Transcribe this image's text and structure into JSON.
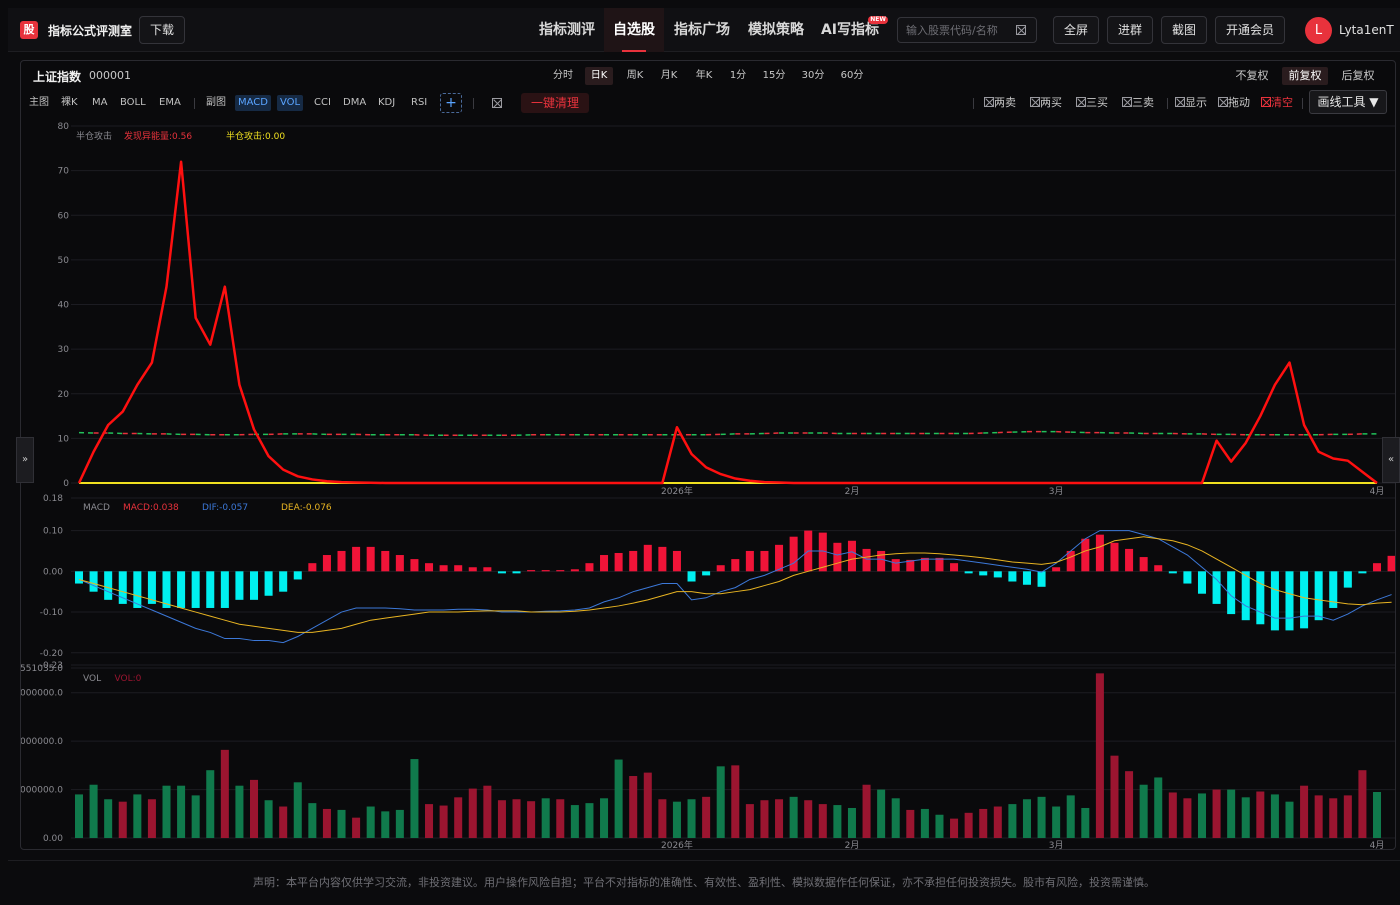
{
  "app": {
    "logo_char": "股",
    "title": "指标公式评测室",
    "download_label": "下载"
  },
  "nav": [
    {
      "label": "指标测评",
      "active": false
    },
    {
      "label": "自选股",
      "active": true
    },
    {
      "label": "指标广场",
      "active": false
    },
    {
      "label": "模拟策略",
      "active": false
    },
    {
      "label": "AI写指标",
      "active": false,
      "badge": "NEW"
    }
  ],
  "search": {
    "placeholder": "输入股票代码/名称"
  },
  "header_buttons": {
    "fullscreen": "全屏",
    "join_group": "进群",
    "screenshot": "截图",
    "vip": "开通会员"
  },
  "user": {
    "avatar_letter": "L",
    "name": "Lyta1enT"
  },
  "stock": {
    "name": "上证指数",
    "code": "000001"
  },
  "periods": [
    {
      "label": "分时",
      "active": false
    },
    {
      "label": "日K",
      "active": true
    },
    {
      "label": "周K",
      "active": false
    },
    {
      "label": "月K",
      "active": false
    },
    {
      "label": "年K",
      "active": false
    },
    {
      "label": "1分",
      "active": false
    },
    {
      "label": "15分",
      "active": false
    },
    {
      "label": "30分",
      "active": false
    },
    {
      "label": "60分",
      "active": false
    }
  ],
  "adjust": [
    {
      "label": "不复权",
      "active": false
    },
    {
      "label": "前复权",
      "active": true
    },
    {
      "label": "后复权",
      "active": false
    }
  ],
  "indicator_tools": {
    "main_label": "主图",
    "main_items": [
      "裸K",
      "MA",
      "BOLL",
      "EMA"
    ],
    "sub_label": "副图",
    "sub_items": [
      "MACD",
      "VOL",
      "CCI",
      "DMA",
      "KDJ",
      "RSI"
    ],
    "add": "+",
    "clear": "一键清理"
  },
  "draw_tools": [
    {
      "label": "两卖",
      "red": false
    },
    {
      "label": "两买",
      "red": false
    },
    {
      "label": "三买",
      "red": false
    },
    {
      "label": "三卖",
      "red": false
    },
    {
      "label": "显示",
      "red": false
    },
    {
      "label": "拖动",
      "red": false
    },
    {
      "label": "清空",
      "red": true
    }
  ],
  "draw_button": "画线工具 ▼",
  "side_tabs": {
    "left": "»",
    "right": "«"
  },
  "colors": {
    "accent": "#e8323c",
    "up": "#f01438",
    "down": "#00f0f0",
    "vol_up": "#9b1530",
    "vol_down": "#107a4c",
    "dif": "#3c78d8",
    "dea": "#e8b422",
    "signal_yellow": "#f0e020"
  },
  "chart_data": [
    {
      "type": "line",
      "legend": [
        {
          "name": "半仓攻击",
          "value": "",
          "color": "#8a8a90"
        },
        {
          "name": "发现异能量",
          "value": "0.56",
          "color": "#e8323c"
        },
        {
          "name": "半仓攻击",
          "value": "0.00",
          "color": "#f0e020"
        }
      ],
      "ylim": [
        0,
        80
      ],
      "yticks": [
        0,
        10,
        20,
        30,
        40,
        50,
        60,
        70,
        80
      ],
      "x_labels": [
        "2026年",
        "2月",
        "3月",
        "4月"
      ],
      "x_label_index": [
        41,
        53,
        67,
        89
      ],
      "n": 90,
      "series": [
        {
          "name": "发现异能量",
          "color": "#ff1010",
          "values": [
            0,
            7,
            13,
            16,
            22,
            27,
            44,
            72,
            37,
            31,
            44,
            22,
            12,
            6,
            3,
            1.5,
            0.8,
            0.4,
            0.2,
            0.1,
            0.05,
            0,
            0,
            0,
            0,
            0,
            0,
            0,
            0,
            0,
            0,
            0,
            0,
            0,
            0,
            0,
            0,
            0,
            0,
            0,
            0,
            12.5,
            6.5,
            3.5,
            2,
            1,
            0.5,
            0.2,
            0.1,
            0,
            0,
            0,
            0,
            0,
            0,
            0,
            0,
            0,
            0,
            0,
            0,
            0,
            0,
            0,
            0,
            0,
            0,
            0,
            0,
            0,
            0,
            0,
            0,
            0,
            0,
            0,
            0,
            0,
            9.5,
            4.8,
            9,
            15,
            22,
            27,
            13,
            7,
            5.5,
            5,
            2.5,
            0
          ]
        },
        {
          "name": "半仓攻击",
          "color": "#f0e020",
          "values": [
            0,
            0,
            0,
            0,
            0,
            0,
            0,
            0,
            0,
            0,
            0,
            0,
            0,
            0,
            0,
            0,
            0,
            0,
            0,
            0,
            0,
            0,
            0,
            0,
            0,
            0,
            0,
            0,
            0,
            0,
            0,
            0,
            0,
            0,
            0,
            0,
            0,
            0,
            0,
            0,
            0,
            0,
            0,
            0,
            0,
            0,
            0,
            0,
            0,
            0,
            0,
            0,
            0,
            0,
            0,
            0,
            0,
            0,
            0,
            0,
            0,
            0,
            0,
            0,
            0,
            0,
            0,
            0,
            0,
            0,
            0,
            0,
            0,
            0,
            0,
            0,
            0,
            0,
            0,
            0,
            0,
            0,
            0,
            0,
            0,
            0,
            0,
            0,
            0,
            0
          ]
        },
        {
          "name": "dashed-level",
          "color": "#22c05a",
          "alt_color": "#e8323c",
          "dashed": true,
          "values": [
            11.3,
            11.2,
            11.2,
            11.1,
            11.1,
            11,
            11,
            10.9,
            10.9,
            10.8,
            10.8,
            10.8,
            10.9,
            10.9,
            11,
            11,
            11,
            10.9,
            10.9,
            10.9,
            10.8,
            10.8,
            10.8,
            10.8,
            10.7,
            10.7,
            10.7,
            10.7,
            10.7,
            10.7,
            10.7,
            10.8,
            10.8,
            10.8,
            10.8,
            10.8,
            10.8,
            10.8,
            10.8,
            10.8,
            10.8,
            10.8,
            10.8,
            10.8,
            10.9,
            11,
            11,
            11.1,
            11.2,
            11.2,
            11.2,
            11.2,
            11.1,
            11.1,
            11.1,
            11.1,
            11.1,
            11.1,
            11.1,
            11.1,
            11.1,
            11.1,
            11.2,
            11.3,
            11.4,
            11.5,
            11.5,
            11.5,
            11.4,
            11.3,
            11.3,
            11.2,
            11.2,
            11.1,
            11.1,
            11.1,
            11,
            11,
            10.9,
            10.9,
            10.8,
            10.8,
            10.8,
            10.8,
            10.8,
            10.8,
            10.9,
            10.9,
            11,
            11
          ]
        }
      ]
    },
    {
      "type": "bar",
      "legend": [
        {
          "name": "MACD",
          "value": "",
          "color": "#8a8a90"
        },
        {
          "name": "MACD",
          "value": "0.038",
          "color": "#e8323c"
        },
        {
          "name": "DIF",
          "value": "-0.057",
          "color": "#3c78d8"
        },
        {
          "name": "DEA",
          "value": "-0.076",
          "color": "#e8b422"
        }
      ],
      "ylim": [
        -0.23,
        0.18
      ],
      "yticks": [
        0.18,
        0.1,
        0.0,
        -0.1,
        -0.2,
        -0.23
      ],
      "ytick_labels": [
        "0.18",
        "0.10",
        "0.00",
        "-0.10",
        "-0.20",
        "-0.23"
      ],
      "macd": [
        -0.03,
        -0.05,
        -0.07,
        -0.08,
        -0.09,
        -0.08,
        -0.09,
        -0.09,
        -0.09,
        -0.09,
        -0.09,
        -0.07,
        -0.07,
        -0.06,
        -0.05,
        -0.02,
        0.02,
        0.04,
        0.05,
        0.06,
        0.06,
        0.05,
        0.04,
        0.03,
        0.02,
        0.015,
        0.015,
        0.01,
        0.01,
        -0.005,
        -0.005,
        0.003,
        0.003,
        0.003,
        0.005,
        0.02,
        0.04,
        0.045,
        0.05,
        0.065,
        0.06,
        0.05,
        -0.025,
        -0.01,
        0.015,
        0.03,
        0.05,
        0.05,
        0.065,
        0.085,
        0.1,
        0.095,
        0.07,
        0.075,
        0.055,
        0.05,
        0.03,
        0.028,
        0.033,
        0.033,
        0.02,
        -0.005,
        -0.01,
        -0.015,
        -0.025,
        -0.033,
        -0.038,
        0.01,
        0.05,
        0.08,
        0.09,
        0.07,
        0.055,
        0.035,
        0.015,
        -0.005,
        -0.03,
        -0.055,
        -0.08,
        -0.105,
        -0.12,
        -0.13,
        -0.145,
        -0.145,
        -0.14,
        -0.12,
        -0.09,
        -0.04,
        -0.005,
        0.02,
        0.038
      ],
      "dif": [
        -0.02,
        -0.035,
        -0.05,
        -0.065,
        -0.08,
        -0.095,
        -0.11,
        -0.125,
        -0.14,
        -0.15,
        -0.165,
        -0.165,
        -0.17,
        -0.17,
        -0.175,
        -0.16,
        -0.14,
        -0.12,
        -0.1,
        -0.09,
        -0.09,
        -0.09,
        -0.092,
        -0.095,
        -0.095,
        -0.095,
        -0.093,
        -0.093,
        -0.095,
        -0.1,
        -0.1,
        -0.1,
        -0.098,
        -0.097,
        -0.095,
        -0.09,
        -0.075,
        -0.065,
        -0.05,
        -0.04,
        -0.03,
        -0.03,
        -0.07,
        -0.065,
        -0.05,
        -0.04,
        -0.02,
        -0.01,
        0.005,
        0.02,
        0.05,
        0.05,
        0.04,
        0.048,
        0.03,
        0.03,
        0.02,
        0.025,
        0.03,
        0.03,
        0.03,
        0.025,
        0.02,
        0.015,
        0.01,
        0.005,
        -0.002,
        0.02,
        0.05,
        0.08,
        0.1,
        0.1,
        0.1,
        0.09,
        0.08,
        0.06,
        0.04,
        0.01,
        -0.02,
        -0.06,
        -0.085,
        -0.1,
        -0.115,
        -0.115,
        -0.11,
        -0.11,
        -0.12,
        -0.105,
        -0.085,
        -0.07,
        -0.057
      ],
      "dea": [
        -0.02,
        -0.03,
        -0.04,
        -0.05,
        -0.06,
        -0.07,
        -0.08,
        -0.09,
        -0.1,
        -0.11,
        -0.12,
        -0.13,
        -0.135,
        -0.14,
        -0.145,
        -0.15,
        -0.15,
        -0.145,
        -0.14,
        -0.13,
        -0.12,
        -0.115,
        -0.11,
        -0.105,
        -0.1,
        -0.1,
        -0.1,
        -0.098,
        -0.097,
        -0.097,
        -0.097,
        -0.1,
        -0.1,
        -0.1,
        -0.098,
        -0.095,
        -0.09,
        -0.085,
        -0.078,
        -0.07,
        -0.06,
        -0.05,
        -0.05,
        -0.055,
        -0.055,
        -0.05,
        -0.045,
        -0.035,
        -0.025,
        -0.01,
        0,
        0.01,
        0.02,
        0.03,
        0.035,
        0.04,
        0.043,
        0.045,
        0.045,
        0.043,
        0.04,
        0.037,
        0.033,
        0.028,
        0.023,
        0.02,
        0.017,
        0.022,
        0.035,
        0.05,
        0.06,
        0.075,
        0.08,
        0.085,
        0.08,
        0.075,
        0.065,
        0.05,
        0.03,
        0.01,
        -0.01,
        -0.03,
        -0.045,
        -0.055,
        -0.065,
        -0.07,
        -0.075,
        -0.08,
        -0.082,
        -0.078,
        -0.076
      ]
    },
    {
      "type": "bar",
      "legend": [
        {
          "name": "VOL",
          "value": "",
          "color": "#8a8a90"
        },
        {
          "name": "VOL",
          "value": "0",
          "color": "#9b1530"
        }
      ],
      "ylim": [
        0,
        351035
      ],
      "yticks": [
        0,
        100000,
        200000,
        300000,
        351035
      ],
      "ytick_labels": [
        "0.00",
        "000000.0",
        "000000.0",
        "000000.0",
        "551035.0"
      ],
      "x_labels": [
        "2026年",
        "2月",
        "3月",
        "4月"
      ],
      "volume": [
        90,
        110,
        80,
        75,
        90,
        80,
        108,
        108,
        88,
        140,
        182,
        108,
        120,
        78,
        65,
        115,
        72,
        60,
        58,
        42,
        65,
        55,
        58,
        163,
        70,
        67,
        84,
        102,
        108,
        78,
        80,
        76,
        82,
        80,
        68,
        72,
        82,
        162,
        128,
        135,
        80,
        75,
        80,
        85,
        148,
        150,
        70,
        78,
        80,
        85,
        78,
        70,
        68,
        62,
        110,
        100,
        82,
        58,
        60,
        48,
        40,
        52,
        60,
        65,
        70,
        80,
        85,
        65,
        88,
        62,
        340,
        170,
        138,
        110,
        125,
        94,
        82,
        92,
        100,
        100,
        84,
        96,
        90,
        75,
        108,
        88,
        82,
        88,
        140,
        95
      ],
      "volume_up": [
        false,
        false,
        false,
        true,
        false,
        true,
        false,
        false,
        false,
        false,
        true,
        false,
        true,
        false,
        true,
        false,
        false,
        true,
        false,
        true,
        false,
        false,
        false,
        false,
        true,
        true,
        true,
        true,
        true,
        true,
        true,
        true,
        false,
        true,
        false,
        false,
        false,
        false,
        true,
        true,
        true,
        false,
        false,
        true,
        false,
        true,
        true,
        true,
        true,
        false,
        true,
        true,
        false,
        false,
        true,
        false,
        false,
        true,
        false,
        false,
        true,
        true,
        true,
        true,
        false,
        false,
        false,
        false,
        false,
        false,
        true,
        true,
        true,
        false,
        false,
        true,
        true,
        false,
        true,
        false,
        false,
        true,
        false,
        false,
        true,
        true,
        true,
        true,
        true,
        false
      ]
    }
  ],
  "footer": "声明：本平台内容仅供学习交流，非投资建议。用户操作风险自担；平台不对指标的准确性、有效性、盈利性、模拟数据作任何保证，亦不承担任何投资损失。股市有风险，投资需谨慎。"
}
